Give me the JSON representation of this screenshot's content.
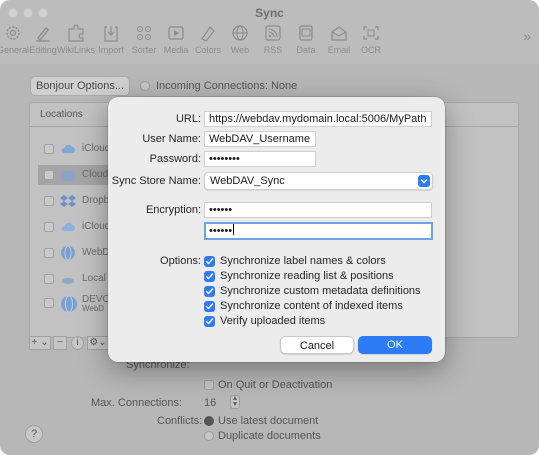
{
  "window": {
    "title": "Sync"
  },
  "toolbar": {
    "items": [
      {
        "label": "General",
        "icon": "gear-icon"
      },
      {
        "label": "Editing",
        "icon": "pen-icon"
      },
      {
        "label": "WikiLinks",
        "icon": "puzzle-icon"
      },
      {
        "label": "Import",
        "icon": "import-icon"
      },
      {
        "label": "Sorter",
        "icon": "sorter-icon"
      },
      {
        "label": "Media",
        "icon": "media-icon"
      },
      {
        "label": "Colors",
        "icon": "colors-icon"
      },
      {
        "label": "Web",
        "icon": "globe-icon"
      },
      {
        "label": "RSS",
        "icon": "rss-icon"
      },
      {
        "label": "Data",
        "icon": "data-icon"
      },
      {
        "label": "Email",
        "icon": "email-icon"
      },
      {
        "label": "OCR",
        "icon": "ocr-icon"
      }
    ],
    "more": "»"
  },
  "background": {
    "bonjour_button": "Bonjour Options...",
    "incoming": "Incoming Connections: None",
    "locations_header": "Locations",
    "locations": [
      {
        "name": "iCloud",
        "icon": "icloud-icon",
        "color": "#7fa8d8"
      },
      {
        "name": "Cloud",
        "icon": "cloud-icon",
        "color": "#7fa8d8"
      },
      {
        "name": "Dropb",
        "icon": "dropbox-icon",
        "color": "#6f90c8"
      },
      {
        "name": "iCloud",
        "icon": "icloud-icon",
        "color": "#8fb0d8"
      },
      {
        "name": "WebD",
        "icon": "webdav-globe-icon",
        "color": "#7c9fd0"
      },
      {
        "name": "Local",
        "icon": "local-disk-icon",
        "color": "#8fa8c8"
      },
      {
        "name": "DEVO",
        "sub": "WebD",
        "icon": "devonthink-globe-icon",
        "color": "#7c9fd0"
      }
    ],
    "bottom_buttons": [
      "+ ⌄",
      "−",
      "i",
      "⚙⌄"
    ],
    "synchronize_label": "Synchronize:",
    "on_quit": "On Quit or Deactivation",
    "max_connections_label": "Max. Connections:",
    "max_connections_value": "16",
    "conflicts_label": "Conflicts:",
    "conflict_options": [
      "Use latest document",
      "Duplicate documents"
    ],
    "help": "?"
  },
  "sheet": {
    "url_label": "URL:",
    "url_value": "https://webdav.mydomain.local:5006/MyPath",
    "username_label": "User Name:",
    "username_value": "WebDAV_Username",
    "password_label": "Password:",
    "password_value": "••••••••",
    "store_label": "Sync Store Name:",
    "store_value": "WebDAV_Sync",
    "encryption_label": "Encryption:",
    "encryption_value": "••••••",
    "encryption_confirm_value": "••••••",
    "options_label": "Options:",
    "options": [
      "Synchronize label names & colors",
      "Synchronize reading list & positions",
      "Synchronize custom metadata definitions",
      "Synchronize content of indexed items",
      "Verify uploaded items"
    ],
    "cancel": "Cancel",
    "ok": "OK"
  },
  "colors": {
    "accent": "#2d7cf6"
  }
}
